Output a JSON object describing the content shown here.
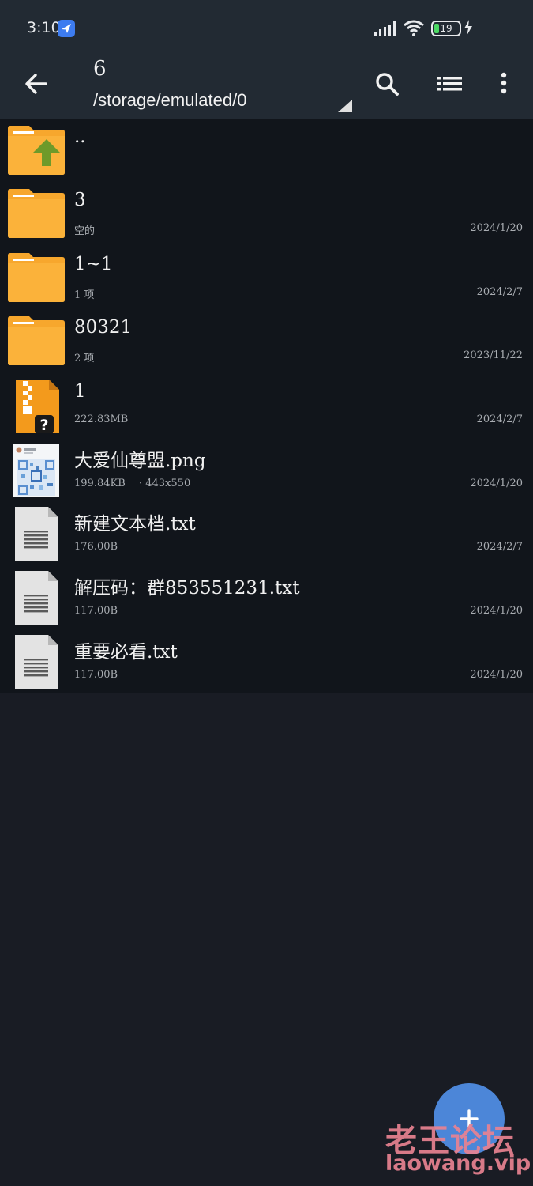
{
  "status_bar": {
    "time": "3:10",
    "battery_level": "19",
    "battery_color": "#4cd964"
  },
  "toolbar": {
    "title": "6",
    "path": "/storage/emulated/0",
    "icons": [
      "back-icon",
      "search-icon",
      "list-view-icon",
      "more-icon"
    ]
  },
  "files": [
    {
      "name": "..",
      "type": "parent",
      "sub": "",
      "dims": "",
      "date": ""
    },
    {
      "name": "3",
      "type": "folder",
      "sub": "空的",
      "dims": "",
      "date": "2024/1/20"
    },
    {
      "name": "1~1",
      "type": "folder",
      "sub": "1 项",
      "dims": "",
      "date": "2024/2/7"
    },
    {
      "name": "80321",
      "type": "folder",
      "sub": "2 项",
      "dims": "",
      "date": "2023/11/22"
    },
    {
      "name": "1",
      "type": "archive",
      "sub": "222.83MB",
      "dims": "",
      "date": "2024/2/7"
    },
    {
      "name": "大爱仙尊盟.png",
      "type": "image",
      "sub": "199.84KB",
      "dims": "· 443x550",
      "date": "2024/1/20"
    },
    {
      "name": "新建文本档.txt",
      "type": "text",
      "sub": "176.00B",
      "dims": "",
      "date": "2024/2/7"
    },
    {
      "name": "解压码：群853551231.txt",
      "type": "text",
      "sub": "117.00B",
      "dims": "",
      "date": "2024/1/20"
    },
    {
      "name": "重要必看.txt",
      "type": "text",
      "sub": "117.00B",
      "dims": "",
      "date": "2024/1/20"
    }
  ],
  "fab": {
    "icon": "plus-icon",
    "color": "#4c86d8"
  },
  "watermark": {
    "cn": "老王论坛",
    "en": "laowang.vip"
  },
  "colors": {
    "folder": "#f7a72d",
    "toolbar": "#222a33",
    "list_bg": "#11151b",
    "page_bg": "#191c24"
  }
}
